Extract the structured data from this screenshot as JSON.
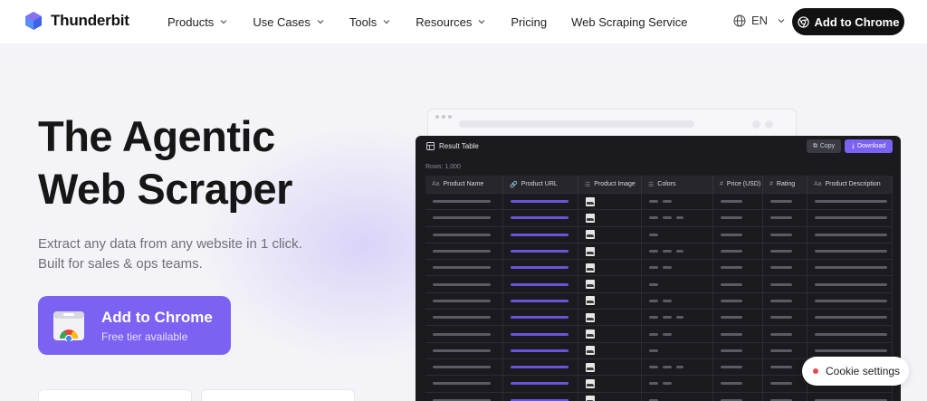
{
  "brand": {
    "name": "Thunderbit",
    "accent": "#7c62f2"
  },
  "nav": {
    "items": [
      {
        "label": "Products",
        "dropdown": true
      },
      {
        "label": "Use Cases",
        "dropdown": true
      },
      {
        "label": "Tools",
        "dropdown": true
      },
      {
        "label": "Resources",
        "dropdown": true
      },
      {
        "label": "Pricing",
        "dropdown": false
      },
      {
        "label": "Web Scraping Service",
        "dropdown": false
      }
    ],
    "language": "EN",
    "cta_label": "Add to Chrome"
  },
  "hero": {
    "title_line1": "The Agentic",
    "title_line2": "Web Scraper",
    "subtitle_line1": "Extract any data from any website in 1 click.",
    "subtitle_line2": "Built for sales & ops teams.",
    "cta_title": "Add to Chrome",
    "cta_subtitle": "Free tier available"
  },
  "result_table": {
    "title": "Result Table",
    "copy_label": "Copy",
    "download_label": "Download",
    "rows_label": "Rows: 1,000",
    "columns": [
      {
        "label": "Product Name",
        "icon": "Aa"
      },
      {
        "label": "Product URL",
        "icon": "🔗"
      },
      {
        "label": "Product Image",
        "icon": "☰"
      },
      {
        "label": "Colors",
        "icon": "☰"
      },
      {
        "label": "Price (USD)",
        "icon": "#"
      },
      {
        "label": "Rating",
        "icon": "#"
      },
      {
        "label": "Product Description",
        "icon": "Aa"
      }
    ]
  },
  "cookie": {
    "label": "Cookie settings"
  }
}
